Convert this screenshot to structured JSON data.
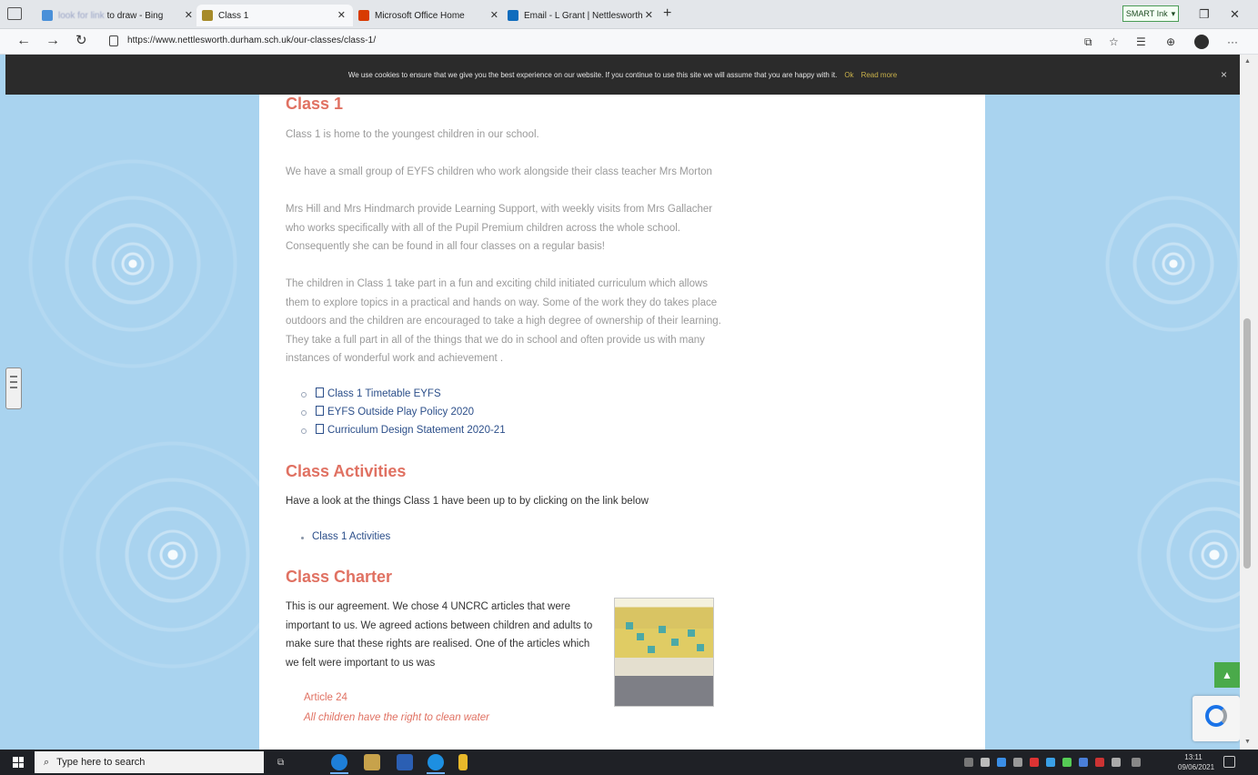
{
  "browser": {
    "tabs": [
      {
        "label": "to draw - Bing",
        "blur_prefix": "look for link",
        "favicon_color": "#4a90d9"
      },
      {
        "label": "Class 1",
        "favicon_color": "#a78b2a",
        "active": true
      },
      {
        "label": "Microsoft Office Home",
        "favicon_color": "#d83b01"
      },
      {
        "label": "Email - L Grant | Nettlesworth",
        "favicon_color": "#0f6cbd"
      }
    ],
    "new_tab": "+",
    "smart_ink_label": "SMART Ink",
    "url": "https://www.nettlesworth.durham.sch.uk/our-classes/class-1/"
  },
  "cookie_notice": {
    "text": "We use cookies to ensure that we give you the best experience on our website. If you continue to use this site we will assume that you are happy with it.",
    "ok_label": "Ok",
    "read_more_label": "Read more",
    "close": "×"
  },
  "class1": {
    "heading": "Class 1",
    "intro": "Class 1 is home to the youngest children in our school.",
    "group": "We have a small group of EYFS children who work alongside their class teacher Mrs Morton",
    "support": "Mrs Hill and Mrs Hindmarch provide Learning Support, with weekly visits from Mrs Gallacher who works specifically with all of the Pupil Premium children across the whole school. Consequently she can be found in all four classes on a regular basis!",
    "curriculum": "The children in Class 1 take part in a fun and exciting child initiated curriculum which allows them to explore topics in a practical and hands on way. Some of the work they do takes place outdoors and the children are encouraged to take a high degree of ownership of their learning. They take a full part in all of the things that we do in school and often provide us with many instances of wonderful work and achievement .",
    "documents": [
      "Class 1 Timetable EYFS",
      "EYFS Outside Play Policy 2020",
      "Curriculum Design Statement 2020-21"
    ]
  },
  "activities": {
    "heading": "Class Activities",
    "text": "Have a look at the things Class 1 have been up to by clicking on the link below",
    "link": "Class 1 Activities"
  },
  "charter": {
    "heading": "Class Charter",
    "text": "This is our agreement. We chose 4 UNCRC articles that were important to us. We agreed actions between children and adults to make sure that these rights are realised. One of the articles which we felt were important to us was",
    "article_title": "Article 24",
    "article_text": "All children have the right to clean water"
  },
  "taskbar": {
    "search_placeholder": "Type here to search",
    "time": "13:11",
    "date": "09/06/2021"
  }
}
